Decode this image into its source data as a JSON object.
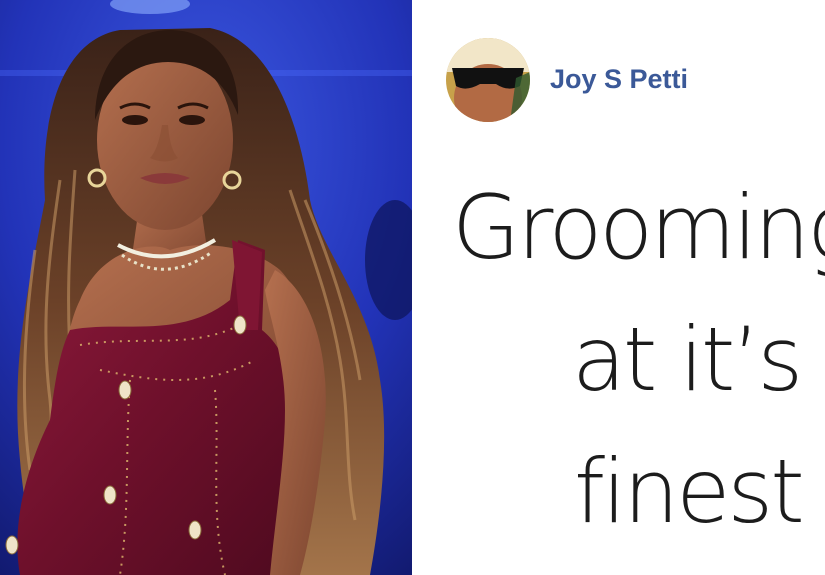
{
  "post": {
    "author": "Joy S Petti",
    "text_lines": [
      "Grooming",
      "at it’s",
      "finest"
    ]
  },
  "colors": {
    "author_link": "#3b5998",
    "photo_background": "#1a2aa8",
    "dress": "#7a1430",
    "text": "#1c1c1c"
  },
  "icons": {
    "avatar": "avatar-with-sunglasses"
  }
}
